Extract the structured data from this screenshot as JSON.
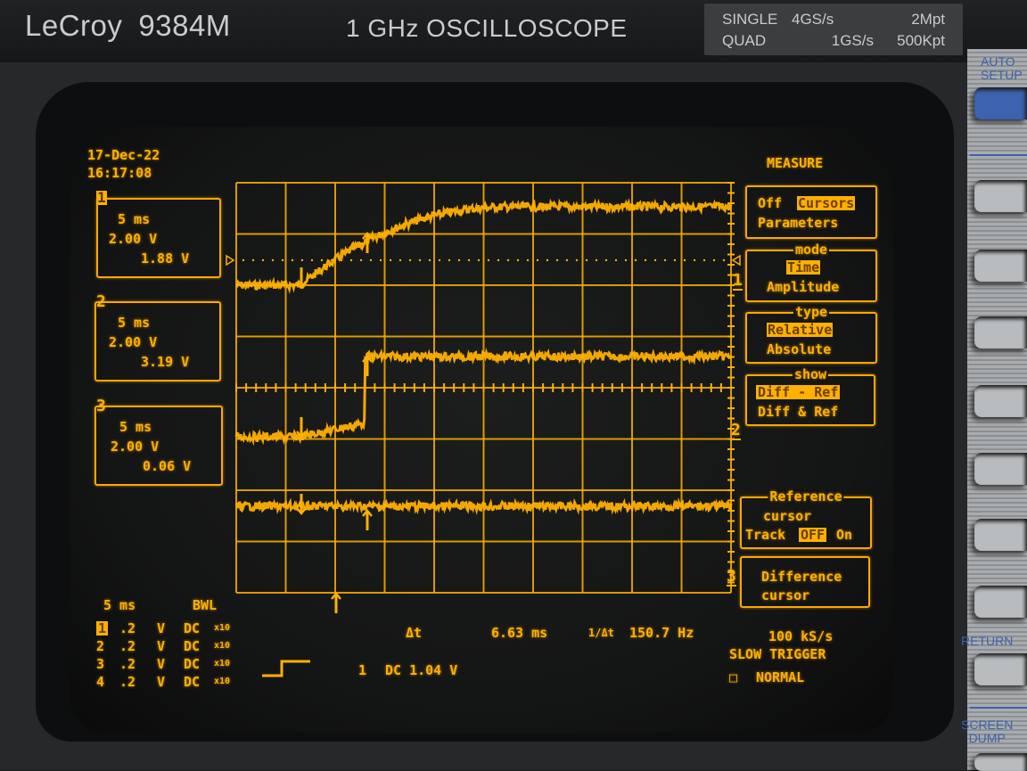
{
  "instrument": {
    "brand": "LeCroy",
    "model": "9384M",
    "tagline": "1 GHz  OSCILLOSCOPE",
    "specs": [
      {
        "mode": "SINGLE",
        "rate": "4GS/s",
        "memory": "2Mpt"
      },
      {
        "mode": "QUAD",
        "rate": "1GS/s",
        "memory": "500Kpt"
      }
    ],
    "panel_labels": {
      "auto_setup": [
        "AUTO",
        "SETUP"
      ],
      "return": "RETURN",
      "screen_dump": [
        "SCREEN",
        "DUMP"
      ]
    }
  },
  "screen": {
    "date": "17-Dec-22",
    "time": "16:17:08",
    "trace_color": "#ffb000",
    "channels": [
      {
        "id": "1",
        "timebase": "5 ms",
        "vdiv": "2.00 V",
        "reading": "1.88 V"
      },
      {
        "id": "2",
        "timebase": "5 ms",
        "vdiv": "2.00 V",
        "reading": "3.19 V"
      },
      {
        "id": "3",
        "timebase": "5 ms",
        "vdiv": "2.00 V",
        "reading": "0.06 V"
      }
    ],
    "menu": {
      "title": "MEASURE",
      "measure": {
        "off": "Off",
        "cursors": "Cursors",
        "parameters": "Parameters",
        "selected": "Cursors"
      },
      "mode": {
        "legend": "mode",
        "options": [
          "Time",
          "Amplitude"
        ],
        "selected": "Time"
      },
      "type": {
        "legend": "type",
        "options": [
          "Relative",
          "Absolute"
        ],
        "selected": "Relative"
      },
      "show": {
        "legend": "show",
        "options": [
          "Diff - Ref",
          "Diff & Ref"
        ],
        "selected": "Diff - Ref"
      },
      "reference": {
        "legend": "Reference",
        "line2": "cursor",
        "track_label": "Track",
        "off": "OFF",
        "on": "On",
        "selected": "OFF"
      },
      "difference": {
        "line1": "Difference",
        "line2": "cursor"
      }
    },
    "markers": {
      "ch1": "1",
      "ch2": "2",
      "ch3": "3"
    },
    "bottom": {
      "timebase": "5 ms",
      "bwl": "BWL",
      "channel_rows": [
        {
          "ch": "1",
          "vdiv": ".2",
          "unit": "V",
          "coupling": "DC",
          "probe": "x10"
        },
        {
          "ch": "2",
          "vdiv": ".2",
          "unit": "V",
          "coupling": "DC",
          "probe": "x10"
        },
        {
          "ch": "3",
          "vdiv": ".2",
          "unit": "V",
          "coupling": "DC",
          "probe": "x10"
        },
        {
          "ch": "4",
          "vdiv": ".2",
          "unit": "V",
          "coupling": "DC",
          "probe": "x10"
        }
      ],
      "delta_t_label": "Δt",
      "delta_t_value": "6.63 ms",
      "inv_delta_t_label": "1/Δt",
      "inv_delta_t_value": "150.7 Hz",
      "trigger_channel": "1",
      "trigger_coupling_level": "DC 1.04 V",
      "sample_rate": "100 kS/s",
      "trigger_type": "SLOW TRIGGER",
      "trigger_mode": "NORMAL"
    }
  }
}
